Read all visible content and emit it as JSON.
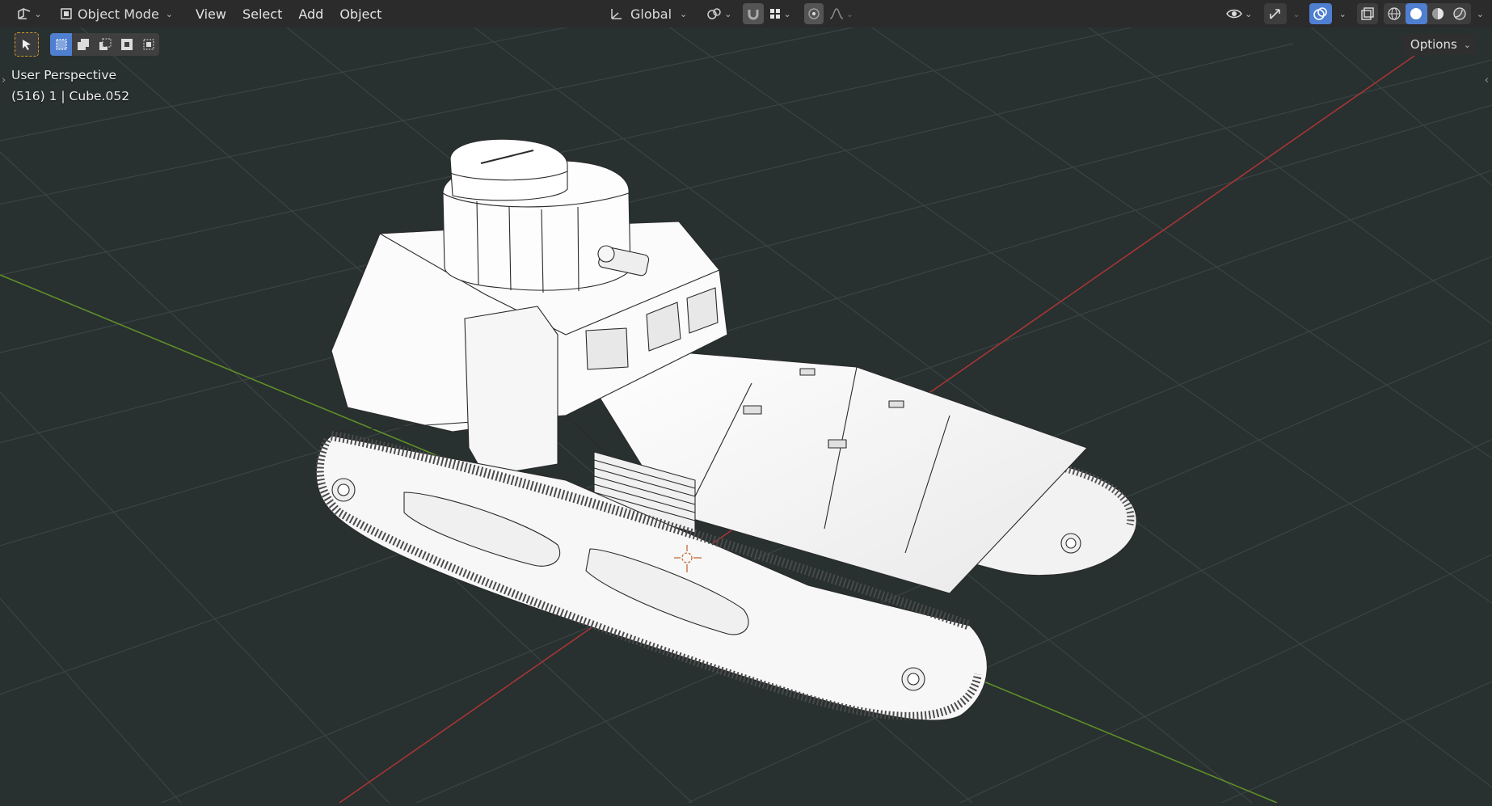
{
  "header": {
    "editor_type_icon": "editor-type-icon",
    "mode": {
      "label": "Object Mode"
    },
    "menus": [
      "View",
      "Select",
      "Add",
      "Object"
    ],
    "transform_orientation": {
      "label": "Global"
    }
  },
  "viewport": {
    "view_name": "User Perspective",
    "object_info": "(516) 1 | Cube.052",
    "options_label": "Options"
  },
  "colors": {
    "header_bg": "#2b2b2b",
    "viewport_bg": "#283030",
    "accent_blue": "#4f7fd0",
    "axis_x": "#b83a3a",
    "axis_y": "#6e9a2a",
    "grid": "#3c4444"
  }
}
